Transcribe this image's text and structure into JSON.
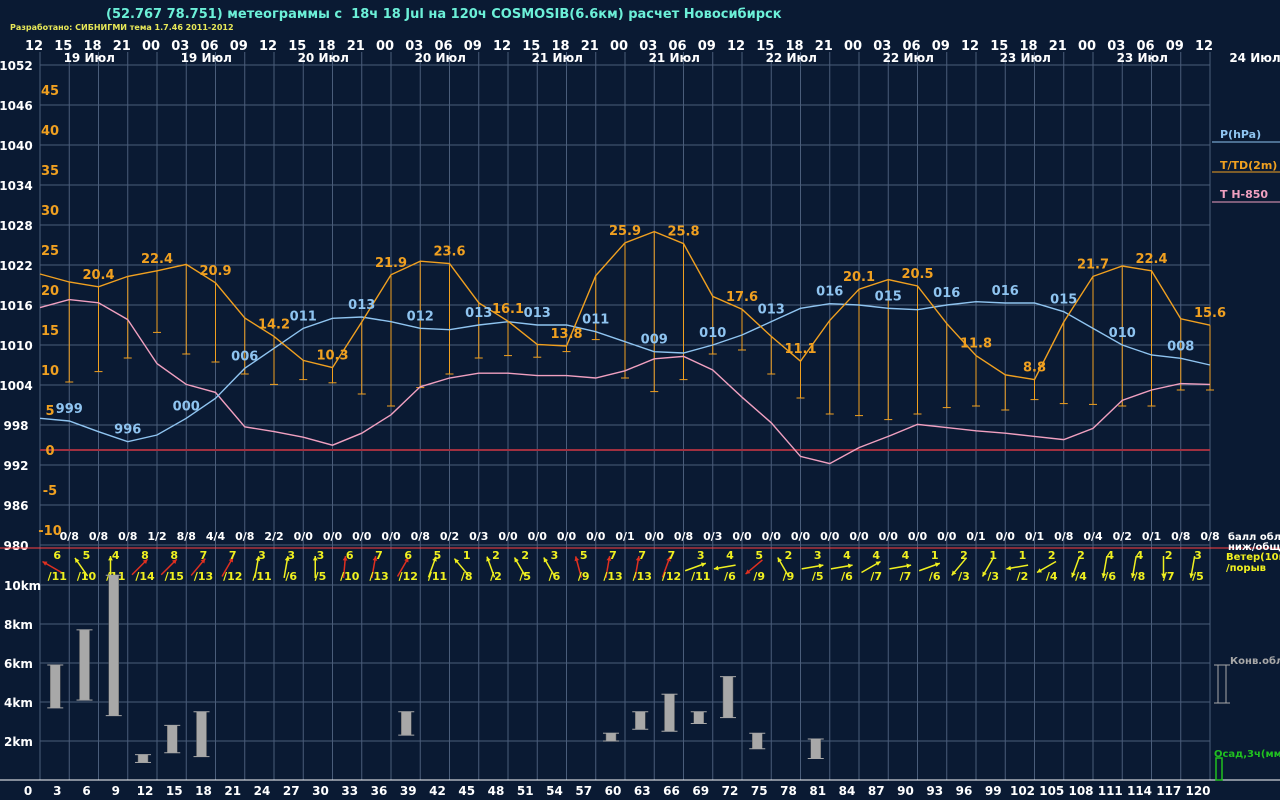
{
  "header": {
    "title": "(52.767 78.751) метеограммы с  18ч 18 Jul на 120ч COSMOSIB(6.6км) расчет Новосибирск",
    "developer": "Разработано: СИБНИГМИ тема 1.7.46 2011-2012"
  },
  "colors": {
    "background": "#0a1a33",
    "grid": "#4a5d7a",
    "pressure": "#8fc4f0",
    "temperature": "#f0a020",
    "t850": "#f0a0c0",
    "zero_line": "#a03040",
    "wind_yellow": "#f0f020",
    "wind_red": "#e03020",
    "cloud_bar": "#a8a8a8",
    "precip": "#20c020",
    "white_text": "#ffffff"
  },
  "chart_data": {
    "type": "line",
    "time_axis_top": {
      "hours": [
        "12",
        "15",
        "18",
        "21",
        "00",
        "03",
        "06",
        "09",
        "12",
        "15",
        "18",
        "21",
        "00",
        "03",
        "06",
        "09",
        "12",
        "15",
        "18",
        "21",
        "00",
        "03",
        "06",
        "09",
        "12",
        "15",
        "18",
        "21",
        "00",
        "03",
        "06",
        "09",
        "12",
        "15",
        "18",
        "21",
        "00",
        "03",
        "06",
        "09",
        "12"
      ],
      "date_labels": [
        "19 Июл",
        "19 Июл",
        "20 Июл",
        "20 Июл",
        "21 Июл",
        "21 Июл",
        "22 Июл",
        "22 Июл",
        "23 Июл",
        "23 Июл"
      ],
      "end_label": "24 Июл"
    },
    "lead_hours": [
      "0",
      "3",
      "6",
      "9",
      "12",
      "15",
      "18",
      "21",
      "24",
      "27",
      "30",
      "33",
      "36",
      "39",
      "42",
      "45",
      "48",
      "51",
      "54",
      "57",
      "60",
      "63",
      "66",
      "69",
      "72",
      "75",
      "78",
      "81",
      "84",
      "87",
      "90",
      "93",
      "96",
      "99",
      "102",
      "105",
      "108",
      "111",
      "114",
      "117",
      "120"
    ],
    "pressure_axis": {
      "label": "P(hPa)",
      "ticks": [
        "1052",
        "1046",
        "1040",
        "1034",
        "1028",
        "1022",
        "1016",
        "1010",
        "1004",
        "998",
        "992",
        "986",
        "980"
      ]
    },
    "temperature_axis": {
      "label": "T/TD(2m)",
      "ticks": [
        "45",
        "40",
        "35",
        "30",
        "25",
        "20",
        "15",
        "10",
        "5",
        "0",
        "-5",
        "-10"
      ]
    },
    "t850_label": "T H-850",
    "series": [
      {
        "name": "P(hPa)",
        "values": [
          999,
          998.6,
          997,
          995.5,
          996.5,
          999,
          1002,
          1006.5,
          1009.5,
          1012.5,
          1014,
          1014.2,
          1013.5,
          1012.5,
          1012.3,
          1013,
          1013.5,
          1013,
          1013,
          1012,
          1010.5,
          1009,
          1008.8,
          1010,
          1011.5,
          1013.5,
          1015.5,
          1016.2,
          1016,
          1015.5,
          1015.3,
          1016,
          1016.5,
          1016.3,
          1016.3,
          1015,
          1012.5,
          1010,
          1008.5,
          1008,
          1007
        ]
      },
      {
        "name": "T/TD(2m)",
        "values": [
          22,
          21,
          20.4,
          21.7,
          22.4,
          23.2,
          20.9,
          16.5,
          14.2,
          11.2,
          10.3,
          16,
          21.9,
          23.6,
          23.3,
          18.4,
          16.1,
          13.2,
          13,
          21.8,
          25.9,
          27.3,
          25.8,
          19.2,
          17.6,
          14.2,
          11.1,
          16.2,
          20.1,
          21.3,
          20.5,
          15.8,
          11.8,
          9.4,
          8.8,
          16,
          21.7,
          23,
          22.4,
          16.4,
          15.6
        ]
      },
      {
        "name": "TD(2m)",
        "values": [
          null,
          8.5,
          9.8,
          11.5,
          14.7,
          12,
          11,
          9.5,
          8.2,
          8.8,
          8.4,
          7,
          5.5,
          7.8,
          9.5,
          11.5,
          11.8,
          11.6,
          12.3,
          13.8,
          9,
          7.3,
          8.8,
          12,
          12.5,
          9.5,
          6.5,
          4.5,
          4.3,
          3.8,
          4.5,
          5.3,
          5.5,
          5,
          6.3,
          5.8,
          5.7,
          5.5,
          5.5,
          7.5,
          7.5
        ]
      },
      {
        "name": "T H-850",
        "values": [
          17.8,
          18.8,
          18.4,
          16.3,
          10.8,
          8.2,
          7.2,
          2.9,
          2.3,
          1.6,
          0.6,
          2.1,
          4.4,
          7.9,
          9,
          9.6,
          9.6,
          9.3,
          9.3,
          9,
          9.9,
          11.4,
          11.7,
          10,
          6.6,
          3.4,
          -0.8,
          -1.7,
          0.3,
          1.7,
          3.2,
          2.8,
          2.4,
          2.1,
          1.7,
          1.3,
          2.7,
          6.2,
          7.5,
          8.3,
          8.2
        ]
      }
    ],
    "temperature_labels": [
      {
        "i": 2,
        "text": "20.4"
      },
      {
        "i": 4,
        "text": "22.4"
      },
      {
        "i": 6,
        "text": "20.9"
      },
      {
        "i": 8,
        "text": "14.2"
      },
      {
        "i": 10,
        "text": "10.3"
      },
      {
        "i": 12,
        "text": "21.9"
      },
      {
        "i": 14,
        "text": "23.6"
      },
      {
        "i": 16,
        "text": "16.1"
      },
      {
        "i": 18,
        "text": "13.8"
      },
      {
        "i": 20,
        "text": "25.9"
      },
      {
        "i": 22,
        "text": "25.8"
      },
      {
        "i": 24,
        "text": "17.6"
      },
      {
        "i": 26,
        "text": "11.1"
      },
      {
        "i": 28,
        "text": "20.1"
      },
      {
        "i": 30,
        "text": "20.5"
      },
      {
        "i": 32,
        "text": "11.8"
      },
      {
        "i": 34,
        "text": "8.8"
      },
      {
        "i": 36,
        "text": "21.7"
      },
      {
        "i": 38,
        "text": "22.4"
      },
      {
        "i": 40,
        "text": "15.6"
      }
    ],
    "pressure_labels": [
      {
        "i": 1,
        "text": "999"
      },
      {
        "i": 3,
        "text": "996"
      },
      {
        "i": 5,
        "text": "000"
      },
      {
        "i": 7,
        "text": "006"
      },
      {
        "i": 9,
        "text": "011"
      },
      {
        "i": 11,
        "text": "013"
      },
      {
        "i": 13,
        "text": "012"
      },
      {
        "i": 15,
        "text": "013"
      },
      {
        "i": 17,
        "text": "013"
      },
      {
        "i": 19,
        "text": "011"
      },
      {
        "i": 21,
        "text": "009"
      },
      {
        "i": 23,
        "text": "010"
      },
      {
        "i": 25,
        "text": "013"
      },
      {
        "i": 27,
        "text": "016"
      },
      {
        "i": 29,
        "text": "015"
      },
      {
        "i": 31,
        "text": "016"
      },
      {
        "i": 33,
        "text": "016"
      },
      {
        "i": 35,
        "text": "015"
      },
      {
        "i": 37,
        "text": "010"
      },
      {
        "i": 39,
        "text": "008"
      }
    ],
    "cloud_cover": {
      "legend": [
        "балл обл.",
        "ниж/общ"
      ],
      "values": [
        "0/8",
        "0/8",
        "0/8",
        "1/2",
        "8/8",
        "4/4",
        "0/8",
        "2/2",
        "0/0",
        "0/0",
        "0/0",
        "0/0",
        "0/8",
        "0/2",
        "0/3",
        "0/0",
        "0/0",
        "0/0",
        "0/0",
        "0/1",
        "0/0",
        "0/8",
        "0/3",
        "0/0",
        "0/0",
        "0/0",
        "0/0",
        "0/0",
        "0/0",
        "0/0",
        "0/0",
        "0/1",
        "0/0",
        "0/1",
        "0/8",
        "0/4",
        "0/2",
        "0/1",
        "0/8",
        "0/8"
      ]
    },
    "wind": {
      "legend": [
        "Ветер(10м)",
        "/порыв"
      ],
      "speed": [
        "6",
        "5",
        "4",
        "8",
        "8",
        "7",
        "7",
        "3",
        "3",
        "3",
        "6",
        "7",
        "6",
        "5",
        "1",
        "2",
        "2",
        "3",
        "5",
        "7",
        "7",
        "7",
        "3",
        "4",
        "5",
        "2",
        "3",
        "4",
        "4",
        "4",
        "1",
        "2",
        "1",
        "1",
        "2",
        "2",
        "4",
        "4",
        "2",
        "3"
      ],
      "gust": [
        "/11",
        "/10",
        "/11",
        "/14",
        "/15",
        "/13",
        "/12",
        "/11",
        "/6",
        "/5",
        "/10",
        "/13",
        "/12",
        "/11",
        "/8",
        "/2",
        "/5",
        "/6",
        "/9",
        "/13",
        "/13",
        "/12",
        "/11",
        "/6",
        "/9",
        "/9",
        "/5",
        "/6",
        "/7",
        "/7",
        "/6",
        "/3",
        "/3",
        "/2",
        "/4",
        "/4",
        "/6",
        "/8",
        "/7",
        "/5"
      ],
      "angle_deg": [
        -60,
        -35,
        0,
        45,
        45,
        40,
        30,
        10,
        10,
        0,
        5,
        10,
        30,
        20,
        -40,
        -20,
        -30,
        -30,
        -15,
        10,
        10,
        20,
        70,
        -100,
        -130,
        -30,
        80,
        80,
        60,
        80,
        70,
        -140,
        -150,
        -100,
        -120,
        -160,
        -170,
        -170,
        180,
        -170
      ],
      "color": [
        "r",
        "y",
        "y",
        "r",
        "r",
        "r",
        "r",
        "y",
        "y",
        "y",
        "r",
        "r",
        "r",
        "y",
        "y",
        "y",
        "y",
        "y",
        "r",
        "r",
        "r",
        "r",
        "y",
        "y",
        "r",
        "y",
        "y",
        "y",
        "y",
        "y",
        "y",
        "y",
        "y",
        "y",
        "y",
        "y",
        "y",
        "y",
        "y",
        "y"
      ]
    },
    "convective_cloud_legend": "Конв.обл.",
    "convective_height_axis": [
      "10km",
      "8km",
      "6km",
      "4km",
      "2km"
    ],
    "convective_clouds": [
      {
        "at": 1,
        "base": 3.7,
        "top": 5.9
      },
      {
        "at": 2,
        "base": 4.1,
        "top": 7.7
      },
      {
        "at": 3,
        "base": 3.3,
        "top": 10.5
      },
      {
        "at": 4,
        "base": 0.9,
        "top": 1.3
      },
      {
        "at": 5,
        "base": 1.4,
        "top": 2.8
      },
      {
        "at": 6,
        "base": 1.2,
        "top": 3.5
      },
      {
        "at": 13,
        "base": 2.3,
        "top": 3.5
      },
      {
        "at": 20,
        "base": 2.0,
        "top": 2.4
      },
      {
        "at": 21,
        "base": 2.6,
        "top": 3.5
      },
      {
        "at": 22,
        "base": 2.5,
        "top": 4.4
      },
      {
        "at": 23,
        "base": 2.9,
        "top": 3.5
      },
      {
        "at": 24,
        "base": 3.2,
        "top": 5.3
      },
      {
        "at": 25,
        "base": 1.6,
        "top": 2.4
      },
      {
        "at": 27,
        "base": 1.1,
        "top": 2.1
      }
    ],
    "precip_legend": "Осад,3ч(мм)",
    "grid": true
  }
}
